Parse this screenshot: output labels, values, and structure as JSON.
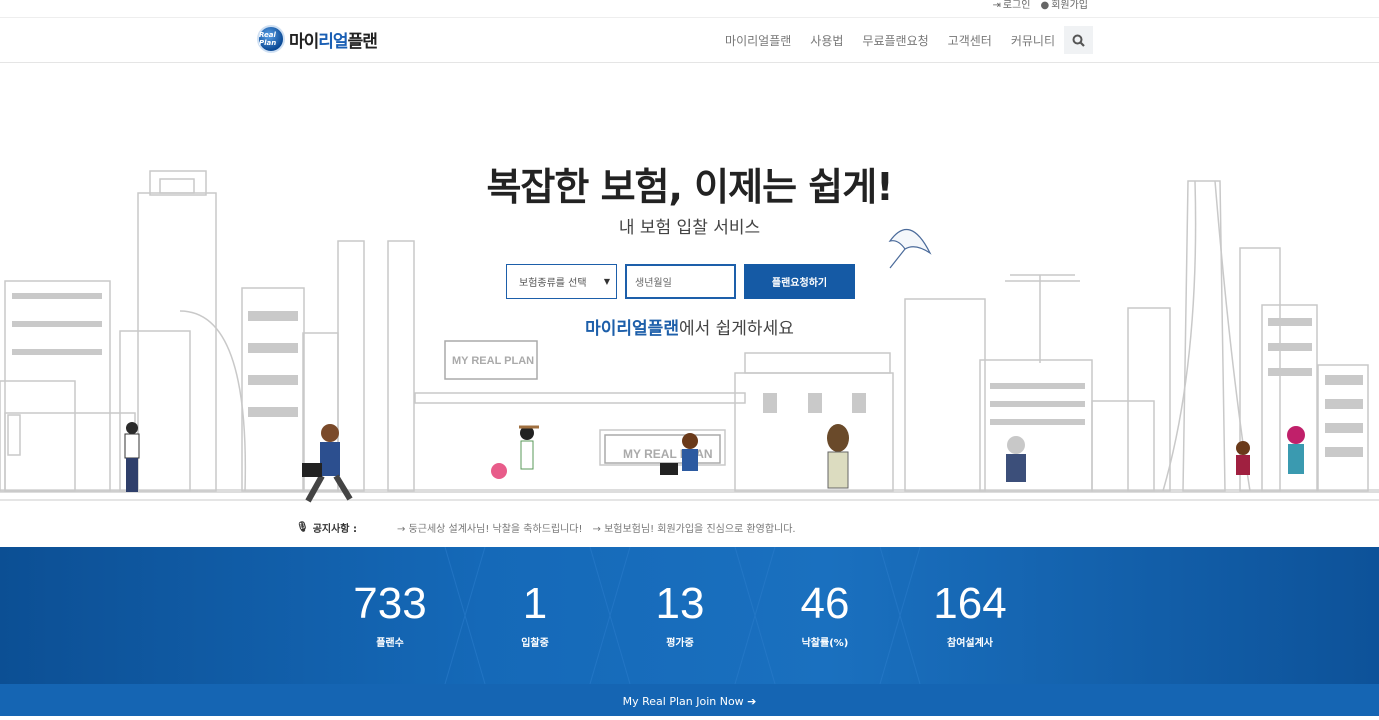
{
  "util": {
    "login": "로그인",
    "signup": "회원가입"
  },
  "logo": {
    "mark": "Real Plan",
    "text_a": "마이",
    "text_b": "리얼",
    "text_c": "플랜"
  },
  "nav": {
    "items": [
      "마이리얼플랜",
      "사용법",
      "무료플랜요청",
      "고객센터",
      "커뮤니티"
    ],
    "search_icon": "search-icon"
  },
  "hero": {
    "title": "복잡한 보험, 이제는 쉽게!",
    "subtitle": "내 보험 입찰 서비스",
    "select_value": "보험종류를 선택",
    "birth_placeholder": "생년월일",
    "request_button": "플랜요청하기",
    "tagline_brand": "마이리얼플랜",
    "tagline_rest": "에서 쉽게하세요",
    "sign1": "MY REAL PLAN",
    "sign2": "MY REAL PLAN"
  },
  "notice": {
    "label": "공지사항 :",
    "items": [
      "→ 둥근세상 설계사님! 낙찰을 축하드립니다!",
      "→ 보험보험님! 회원가입을 진심으로 환영합니다."
    ]
  },
  "stats": [
    {
      "value": "733",
      "label": "플랜수"
    },
    {
      "value": "1",
      "label": "입찰중"
    },
    {
      "value": "13",
      "label": "평가중"
    },
    {
      "value": "46",
      "label": "낙찰률(%)"
    },
    {
      "value": "164",
      "label": "참여설계사"
    }
  ],
  "join": {
    "label": "My Real Plan Join Now ➔"
  },
  "colors": {
    "brand_blue": "#1d5faa",
    "stats_bg": "#1569b8"
  }
}
